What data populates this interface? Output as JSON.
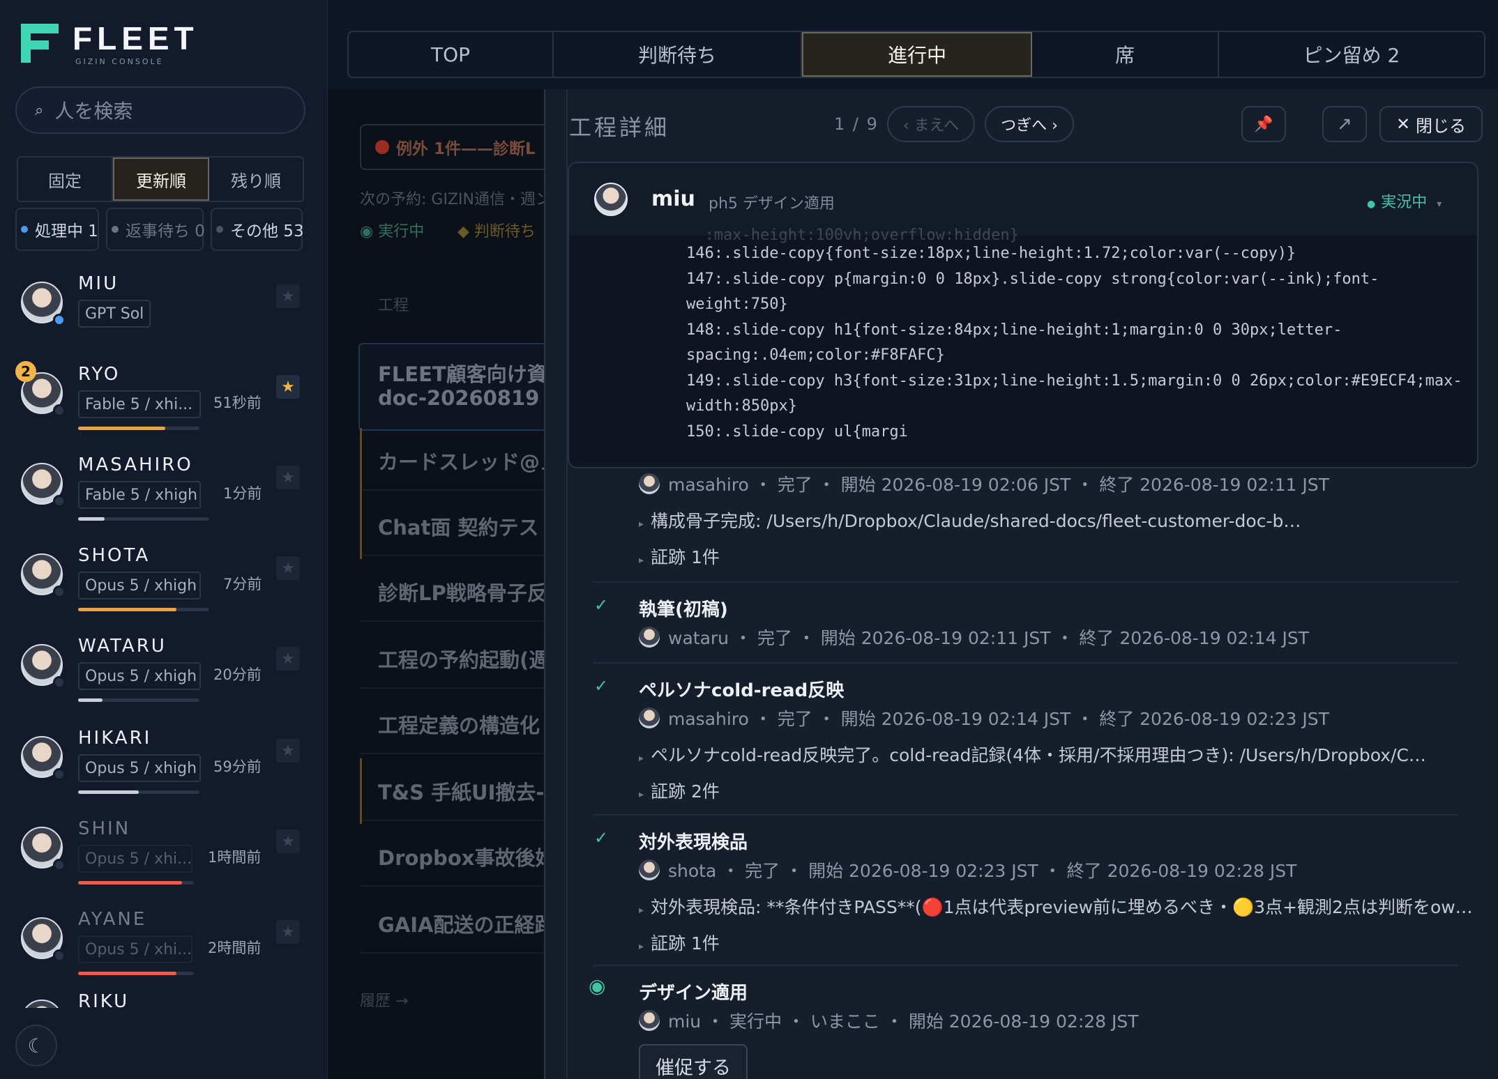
{
  "app": {
    "logo": "FLEET",
    "logo_sub": "GIZIN CONSOLE"
  },
  "search": {
    "placeholder": "人を検索"
  },
  "sort_tabs": [
    "固定",
    "更新順",
    "残り順"
  ],
  "filters": [
    {
      "label": "処理中 1",
      "color": "#4a9cf0"
    },
    {
      "label": "返事待ち 0",
      "color": "#6b7384"
    },
    {
      "label": "その他 53",
      "color": "#4a5263"
    }
  ],
  "people": [
    {
      "name": "MIU",
      "model": "GPT Sol",
      "time": "",
      "progress": 0,
      "progress_color": "#e09a4a",
      "starred": false,
      "status_color": "#4a9cf0",
      "dim": false
    },
    {
      "name": "RYO",
      "model": "Fable 5 / xhi...",
      "time": "51秒前",
      "progress": 0.72,
      "progress_color": "#e8a34a",
      "starred": true,
      "status_color": "#2b3446",
      "dim": false,
      "badge": "2"
    },
    {
      "name": "MASAHIRO",
      "model": "Fable 5 / xhigh",
      "time": "1分前",
      "progress": 0.2,
      "progress_color": "#c9ced8",
      "starred": false,
      "status_color": "#2b3446",
      "dim": false
    },
    {
      "name": "SHOTA",
      "model": "Opus 5 / xhigh",
      "time": "7分前",
      "progress": 0.75,
      "progress_color": "#e8a34a",
      "starred": false,
      "status_color": "#2b3446",
      "dim": false
    },
    {
      "name": "WATARU",
      "model": "Opus 5 / xhigh",
      "time": "20分前",
      "progress": 0.2,
      "progress_color": "#c9ced8",
      "starred": false,
      "status_color": "#2b3446",
      "dim": false
    },
    {
      "name": "HIKARI",
      "model": "Opus 5 / xhigh",
      "time": "59分前",
      "progress": 0.5,
      "progress_color": "#c9ced8",
      "starred": false,
      "status_color": "#2b3446",
      "dim": false
    },
    {
      "name": "SHIN",
      "model": "Opus 5 / xhi...",
      "time": "1時間前",
      "progress": 0.9,
      "progress_color": "#e2604c",
      "starred": false,
      "status_color": "#2b3446",
      "dim": true
    },
    {
      "name": "AYANE",
      "model": "Opus 5 / xhi...",
      "time": "2時間前",
      "progress": 0.85,
      "progress_color": "#e2604c",
      "starred": false,
      "status_color": "#2b3446",
      "dim": true
    },
    {
      "name": "RIKU",
      "model": "",
      "time": "",
      "progress": 0,
      "progress_color": "#2a3446",
      "starred": false,
      "status_color": "#2b3446",
      "dim": false
    }
  ],
  "top_tabs": [
    "TOP",
    "判断待ち",
    "進行中",
    "席",
    "ピン留め 2"
  ],
  "middle": {
    "exception": "例外 1件——診断L",
    "next": "次の予約: GIZIN通信・週ン",
    "running": "実行中",
    "waiting": "判断待ち",
    "section": "工程",
    "items": [
      "FLEET顧客向け資",
      "doc-20260819",
      "カードスレッド@メ",
      "Chat面 契約テスト",
      "診断LP戦略骨子反",
      "工程の予約起動(週",
      "工程定義の構造化",
      "T&S 手紙UI撤去-",
      "Dropbox事故後始",
      "GAIA配送の正経路"
    ],
    "history": "履歴 →"
  },
  "panel": {
    "title": "工程詳細",
    "count": "1 / 9",
    "prev": "‹ まえへ",
    "next": "つぎへ ›",
    "close": "閉じる",
    "card": {
      "user": "miu",
      "task": "ph5 デザイン適用",
      "status": "実況中",
      "code": "146:.slide-copy{font-size:18px;line-height:1.72;color:var(--copy)}\n147:.slide-copy p{margin:0 0 18px}.slide-copy strong{color:var(--ink);font-weight:750}\n148:.slide-copy h1{font-size:84px;line-height:1;margin:0 0 30px;letter-spacing:.04em;color:#F8FAFC}\n149:.slide-copy h3{font-size:31px;line-height:1.5;margin:0 0 26px;color:#E9ECF4;max-width:850px}\n150:.slide-copy ul{margi"
    },
    "steps": [
      {
        "title": "",
        "meta": "masahiro ・ 完了 ・ 開始 2026-08-19 02:06 JST ・ 終了 2026-08-19 02:11 JST",
        "lines": [
          "構成骨子完成: /Users/h/Dropbox/Claude/shared-docs/fleet-customer-doc-b…",
          "証跡 1件"
        ]
      },
      {
        "title": "執筆(初稿)",
        "meta": "wataru ・ 完了 ・ 開始 2026-08-19 02:11 JST ・ 終了 2026-08-19 02:14 JST",
        "lines": []
      },
      {
        "title": "ペルソナcold-read反映",
        "meta": "masahiro ・ 完了 ・ 開始 2026-08-19 02:14 JST ・ 終了 2026-08-19 02:23 JST",
        "lines": [
          "ペルソナcold-read反映完了。cold-read記録(4体・採用/不採用理由つき): /Users/h/Dropbox/C…",
          "証跡 2件"
        ]
      },
      {
        "title": "対外表現検品",
        "meta": "shota ・ 完了 ・ 開始 2026-08-19 02:23 JST ・ 終了 2026-08-19 02:28 JST",
        "lines": [
          "対外表現検品: **条件付きPASS**(🔴1点は代表preview前に埋めるべき・🟡3点+観測2点は判断をow…",
          "証跡 1件"
        ]
      },
      {
        "title": "デザイン適用",
        "meta": "miu ・ 実行中 ・ いまここ ・ 開始 2026-08-19 02:28 JST",
        "lines": []
      }
    ],
    "nudge": "催促する"
  }
}
